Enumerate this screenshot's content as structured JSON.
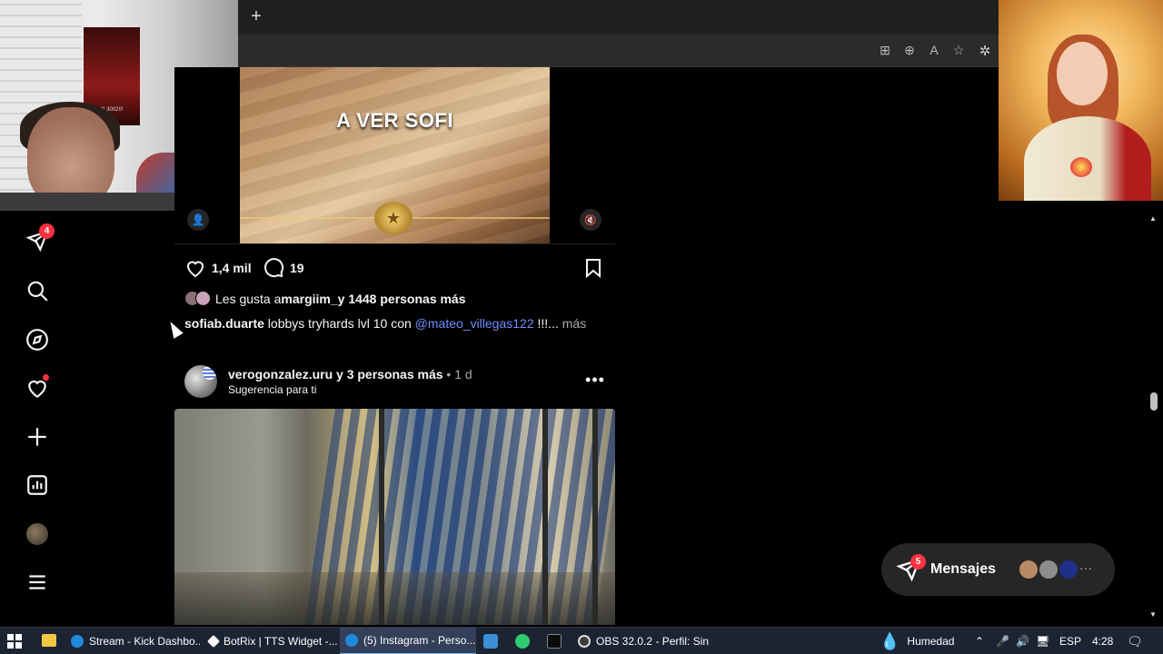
{
  "browser": {
    "new_tab_glyph": "+",
    "address_icons": [
      "add-to-collection-icon",
      "zoom-icon",
      "read-aloud-icon",
      "favorite-star-icon"
    ],
    "extension_icon": "extensions-icon"
  },
  "overlay": {
    "webcam_poster_text": "III 3002!!!"
  },
  "sidebar": {
    "items": [
      {
        "name": "messages-icon",
        "badge": "4"
      },
      {
        "name": "search-icon"
      },
      {
        "name": "explore-icon"
      },
      {
        "name": "notifications-heart-icon",
        "dot": true
      },
      {
        "name": "create-plus-icon"
      },
      {
        "name": "dashboard-icon"
      },
      {
        "name": "profile-avatar"
      },
      {
        "name": "more-menu-icon"
      }
    ]
  },
  "post1": {
    "video_caption": "A VER SOFI",
    "like_count": "1,4 mil",
    "comment_count": "19",
    "likes_prefix": "Les gusta a ",
    "likes_user": "margiim_",
    "likes_suffix": " y 1448 personas más",
    "caption_user": "sofiab.duarte",
    "caption_text": " lobbys tryhards lvl 10 con ",
    "caption_mention": "@mateo_villegas122",
    "caption_tail": " !!!...",
    "caption_more": " más"
  },
  "post2": {
    "user_line": "verogonzalez.uru y 3 personas más",
    "time": " • 1 d",
    "subtitle": "Sugerencia para ti",
    "more_glyph": "•••"
  },
  "messages": {
    "label": "Mensajes",
    "badge": "5",
    "more_glyph": "···"
  },
  "taskbar": {
    "apps": [
      {
        "label": "Stream - Kick Dashbo...",
        "icon_color": "#1f8bd8"
      },
      {
        "label": "BotRix | TTS Widget -...",
        "icon_color": "#ffffff"
      },
      {
        "label": "(5) Instagram - Perso...",
        "icon_color": "#1f8bd8",
        "active": true
      },
      {
        "label": "OBS 32.0.2 - Perfil: Sin...",
        "icon_color": "#3b3b3b"
      }
    ],
    "weather": "Humedad",
    "language": "ESP",
    "time": "4:28"
  }
}
